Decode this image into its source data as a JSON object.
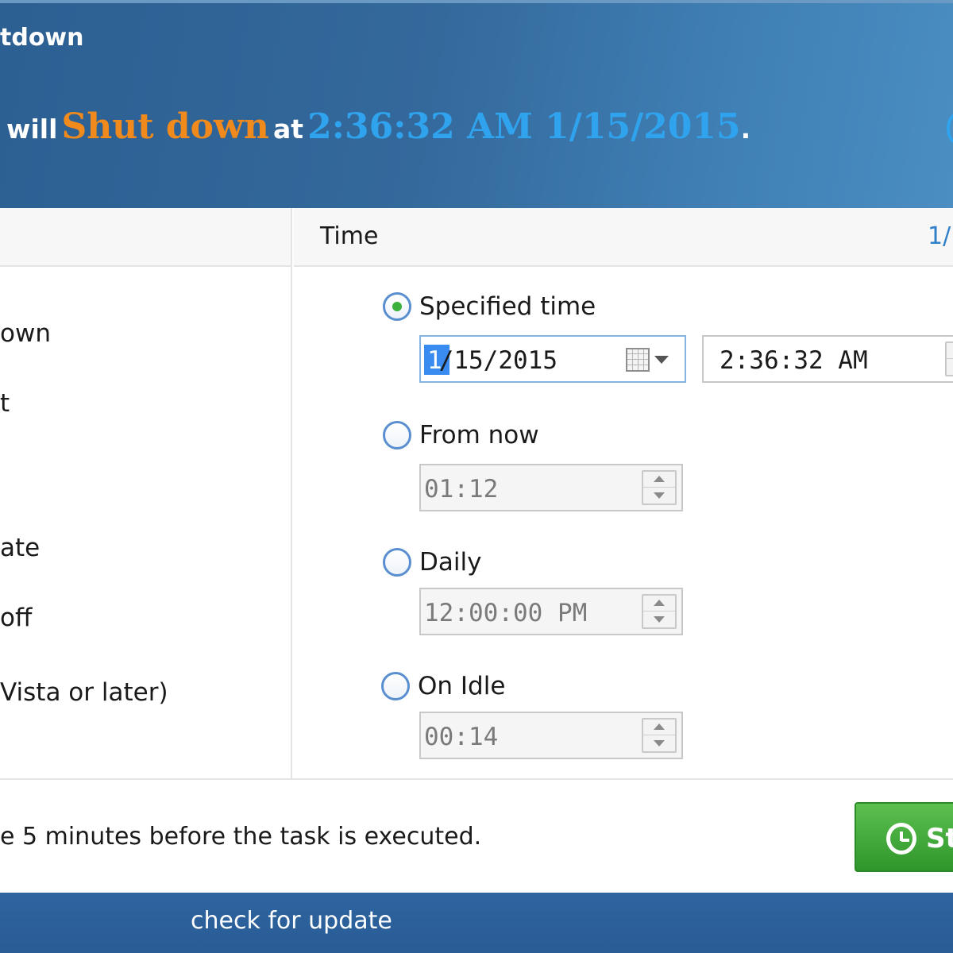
{
  "header": {
    "app_title": "tdown",
    "status": {
      "prefix": "will",
      "action": "Shut down",
      "connector": "at",
      "datetime": "2:36:32 AM 1/15/2015",
      "period": "."
    }
  },
  "left_panel": {
    "items": [
      {
        "label": "own"
      },
      {
        "label": "t"
      },
      {
        "label": ""
      },
      {
        "label": "ate"
      },
      {
        "label": "off"
      },
      {
        "label": "Vista or later)"
      }
    ]
  },
  "time_panel": {
    "header_label": "Time",
    "header_edge_text": "1/",
    "options": [
      {
        "label": "Specified time",
        "selected": true
      },
      {
        "label": "From now",
        "selected": false,
        "value": "01:12"
      },
      {
        "label": "Daily",
        "selected": false,
        "value": "12:00:00 PM"
      },
      {
        "label": "On Idle",
        "selected": false,
        "value": "00:14"
      }
    ],
    "specified_date_selected_part": "1",
    "specified_date_rest": "/15/2015",
    "specified_time": "2:36:32 AM"
  },
  "footer_note": "e 5 minutes before the task is executed.",
  "start_button_label": "St",
  "update_link": "check for update",
  "colors": {
    "header_blue": "#34699c",
    "action_orange": "#f08a1c",
    "time_blue": "#2fa3ee",
    "start_green": "#3fa83a",
    "footer_blue": "#2a5c95"
  },
  "icons": [
    "calendar-icon",
    "dropdown-arrow-icon",
    "spinner-up-icon",
    "spinner-down-icon",
    "alarm-clock-icon"
  ]
}
